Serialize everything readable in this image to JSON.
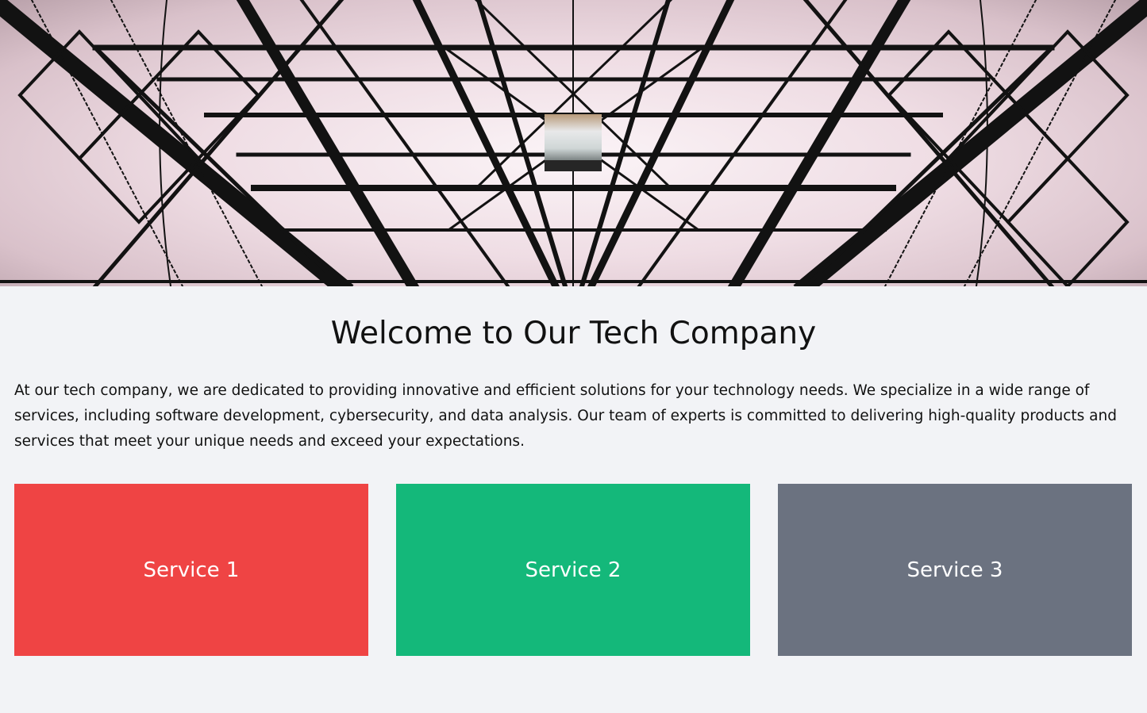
{
  "hero": {
    "background_image": "electricity-pylon-lattice",
    "logo_image": "company-logo-thumbnail"
  },
  "main": {
    "title": "Welcome to Our Tech Company",
    "intro": "At our tech company, we are dedicated to providing innovative and efficient solutions for your technology needs. We specialize in a wide range of services, including software development, cybersecurity, and data analysis. Our team of experts is committed to delivering high-quality products and services that meet your unique needs and exceed your expectations."
  },
  "services": [
    {
      "label": "Service 1",
      "color": "#ef4444"
    },
    {
      "label": "Service 2",
      "color": "#14b87a"
    },
    {
      "label": "Service 3",
      "color": "#6b7280"
    }
  ],
  "colors": {
    "page_background": "#f2f3f6",
    "text": "#111111",
    "service_text": "#ffffff"
  }
}
